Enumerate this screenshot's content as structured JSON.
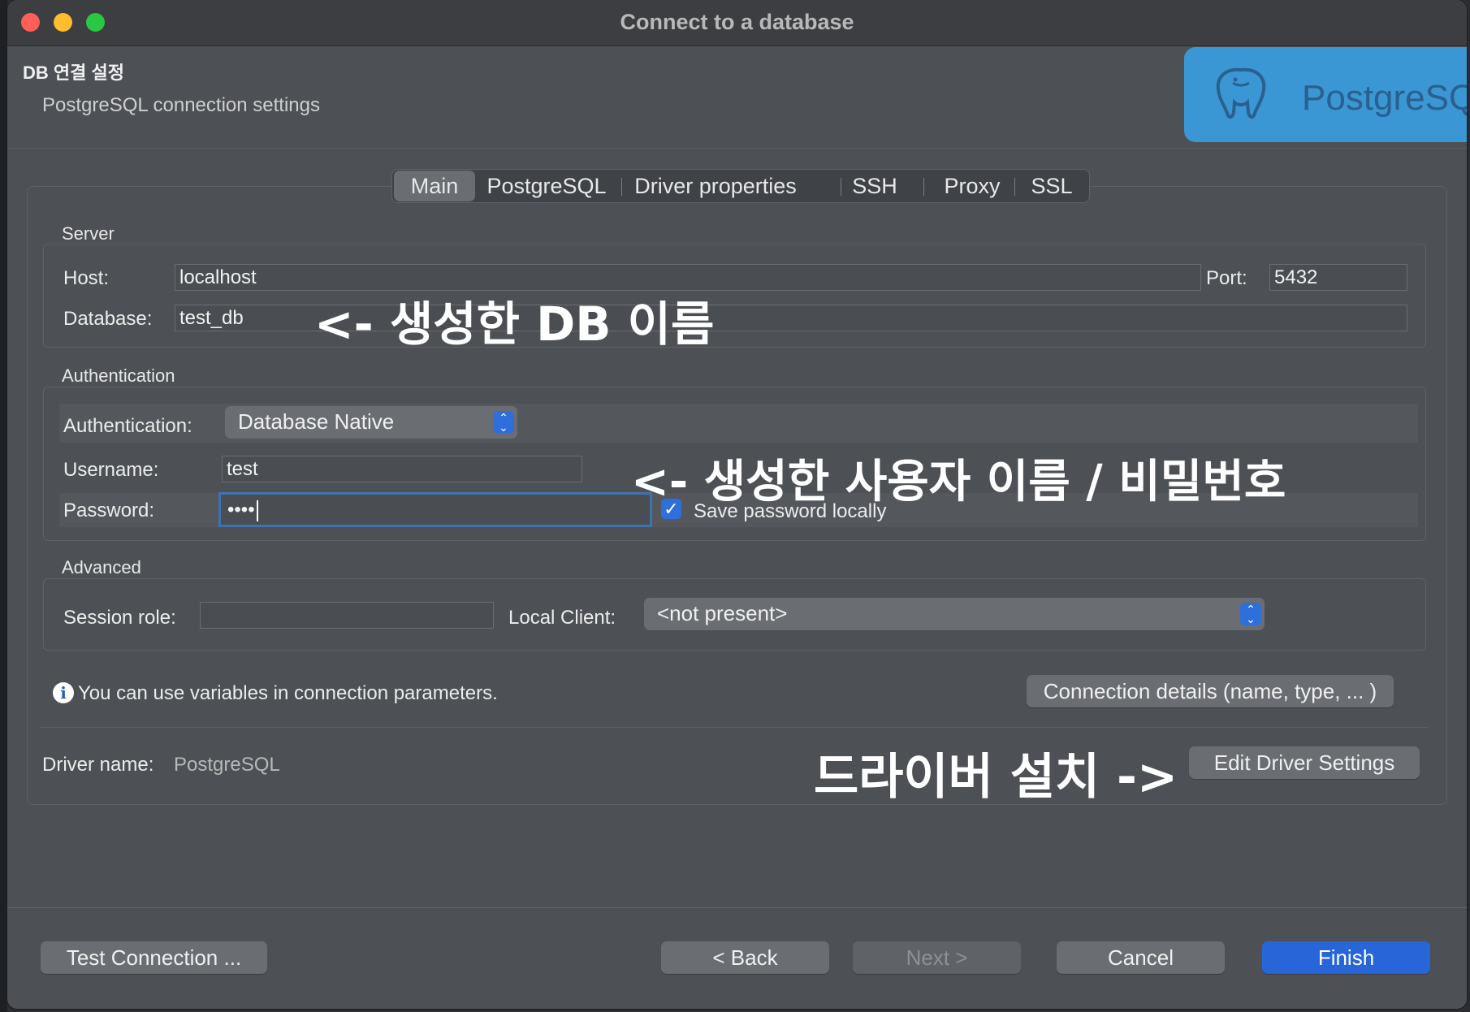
{
  "window": {
    "title": "Connect to a database"
  },
  "header": {
    "title": "DB 연결 설정",
    "subtitle": "PostgreSQL connection settings",
    "logo_text": "PostgreSQL"
  },
  "tabs": [
    {
      "label": "Main",
      "active": true
    },
    {
      "label": "PostgreSQL"
    },
    {
      "label": "Driver properties"
    },
    {
      "label": "SSH"
    },
    {
      "label": "Proxy"
    },
    {
      "label": "SSL"
    }
  ],
  "server": {
    "group_label": "Server",
    "host_label": "Host:",
    "host_value": "localhost",
    "port_label": "Port:",
    "port_value": "5432",
    "database_label": "Database:",
    "database_value": "test_db"
  },
  "auth": {
    "group_label": "Authentication",
    "auth_label": "Authentication:",
    "auth_value": "Database Native",
    "username_label": "Username:",
    "username_value": "test",
    "password_label": "Password:",
    "password_value": "••••",
    "save_password_label": "Save password locally",
    "save_password_checked": true
  },
  "advanced": {
    "group_label": "Advanced",
    "session_role_label": "Session role:",
    "session_role_value": "",
    "local_client_label": "Local Client:",
    "local_client_value": "<not present>"
  },
  "info": {
    "text": "You can use variables in connection parameters.",
    "details_button": "Connection details (name, type, ... )"
  },
  "driver": {
    "label": "Driver name:",
    "value": "PostgreSQL",
    "edit_button": "Edit Driver Settings"
  },
  "annotations": {
    "db_name": "<- 생성한 DB 이름",
    "user_pass": "<- 생성한 사용자 이름 / 비밀번호",
    "driver_install": "드라이버 설치 ->"
  },
  "footer": {
    "test_connection": "Test Connection ...",
    "back": "< Back",
    "next": "Next >",
    "cancel": "Cancel",
    "finish": "Finish"
  },
  "colors": {
    "accent": "#2865d8",
    "logo_bg": "#3a97d3",
    "window_bg": "#4d5155"
  }
}
